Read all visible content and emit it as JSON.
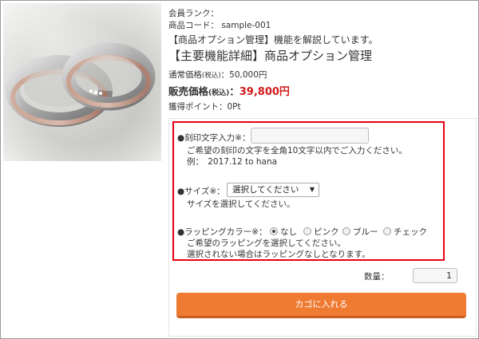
{
  "product": {
    "member_rank_label": "会員ランク：",
    "code_label": "商品コード：",
    "code_value": "sample-001",
    "description": "【商品オプション管理】機能を解説しています。",
    "title": "【主要機能詳細】商品オプション管理",
    "regular_price_label": "通常価格",
    "regular_price_tax": "(税込)",
    "regular_price_value": "：50,000円",
    "sale_price_label": "販売価格",
    "sale_price_tax": "(税込)",
    "sale_price_sep": "：",
    "sale_price_value": "39,800円",
    "points_label": "獲得ポイント：",
    "points_value": "0Pt"
  },
  "options": {
    "engraving": {
      "label": "●刻印文字入力※：",
      "value": "",
      "help1": "ご希望の刻印の文字を全角10文字以内でご入力ください。",
      "help2": "例：　2017.12 to hana"
    },
    "size": {
      "label": "●サイズ※：",
      "selected": "選択してください",
      "help": "サイズを選択してください。"
    },
    "wrapping": {
      "label": "●ラッピングカラー※：",
      "choices": [
        "なし",
        "ピンク",
        "ブルー",
        "チェック"
      ],
      "selected_index": 0,
      "help1": "ご希望のラッピングを選択してください。",
      "help2": "選択されない場合はラッピングなしとなります。"
    }
  },
  "quantity": {
    "label": "数量：",
    "value": "1"
  },
  "cart_button": {
    "label": "カゴに入れる"
  },
  "colors": {
    "accent": "#ef7b33",
    "price_red": "#d11a1a",
    "highlight_border": "#e60012"
  }
}
